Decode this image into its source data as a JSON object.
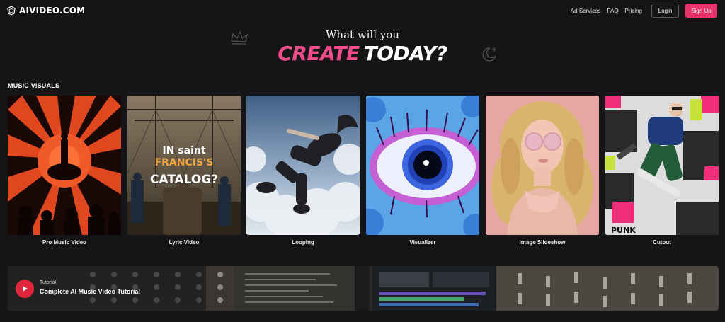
{
  "header": {
    "logo_text": "AIVIDEO.COM",
    "nav": [
      "Ad Services",
      "FAQ",
      "Pricing"
    ],
    "login_label": "Login",
    "signup_label": "Sign Up"
  },
  "hero": {
    "subtitle": "What will you",
    "title_accent": "CREATE",
    "title_rest": "TODAY?"
  },
  "section": {
    "title": "MUSIC VISUALS"
  },
  "cards": [
    {
      "label": "Pro Music Video"
    },
    {
      "label": "Lyric Video",
      "overlay_lines": [
        "IN saint",
        "FRANCIS'S",
        "CATALOG?"
      ]
    },
    {
      "label": "Looping"
    },
    {
      "label": "Visualizer"
    },
    {
      "label": "Image Slideshow"
    },
    {
      "label": "Cutout",
      "overlay_text": "PUNK"
    }
  ],
  "tutorial": {
    "eyebrow": "Tutorial",
    "title": "Complete AI Music Video Tutorial"
  },
  "colors": {
    "background": "#151517",
    "accent_pink": "#e8326c",
    "play_red": "#e0263a"
  }
}
